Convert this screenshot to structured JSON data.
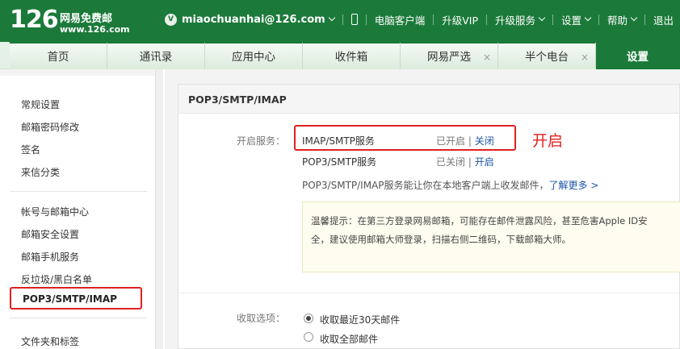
{
  "header": {
    "logo_number": "126",
    "logo_name": "网易免费邮",
    "logo_url": "www.126.com",
    "vip_badge": "V",
    "email": "miaochuanhai@126.com",
    "links": [
      "电脑客户端",
      "升级VIP",
      "升级服务",
      "设置",
      "帮助",
      "退出"
    ]
  },
  "tabs": [
    {
      "label": "首页"
    },
    {
      "label": "通讯录"
    },
    {
      "label": "应用中心"
    },
    {
      "label": "收件箱"
    },
    {
      "label": "网易严选",
      "close": "×"
    },
    {
      "label": "半个电台",
      "close": "×"
    },
    {
      "label": "设置"
    }
  ],
  "sidebar": {
    "group1": [
      "常规设置",
      "邮箱密码修改",
      "签名",
      "来信分类"
    ],
    "group2": [
      "帐号与邮箱中心",
      "邮箱安全设置",
      "邮箱手机服务",
      "反垃圾/黑白名单"
    ],
    "active": "POP3/SMTP/IMAP",
    "group3": [
      "文件夹和标签"
    ]
  },
  "main": {
    "title": "POP3/SMTP/IMAP",
    "service_label": "开启服务：",
    "services": [
      {
        "name": "IMAP/SMTP服务",
        "status": "已开启",
        "sep": "|",
        "action": "关闭"
      },
      {
        "name": "POP3/SMTP服务",
        "status": "已关闭",
        "sep": "|",
        "action": "开启"
      }
    ],
    "annotation": "开启",
    "desc": "POP3/SMTP/IMAP服务能让你在本地客户端上收发邮件，",
    "desc_link": "了解更多 >",
    "tip_line1": "温馨提示：在第三方登录网易邮箱，可能存在邮件泄露风险，甚至危害Apple ID安",
    "tip_line2": "全，建议使用邮箱大师登录，扫描右侧二维码，下载邮箱大师。",
    "receive_label": "收取选项：",
    "receive_options": [
      "收取最近30天邮件",
      "收取全部邮件"
    ],
    "receive_selected": 0
  },
  "colors": {
    "brand_green": "#1b7a3a",
    "highlight_red": "#e02020",
    "link_blue": "#1a55a6"
  }
}
